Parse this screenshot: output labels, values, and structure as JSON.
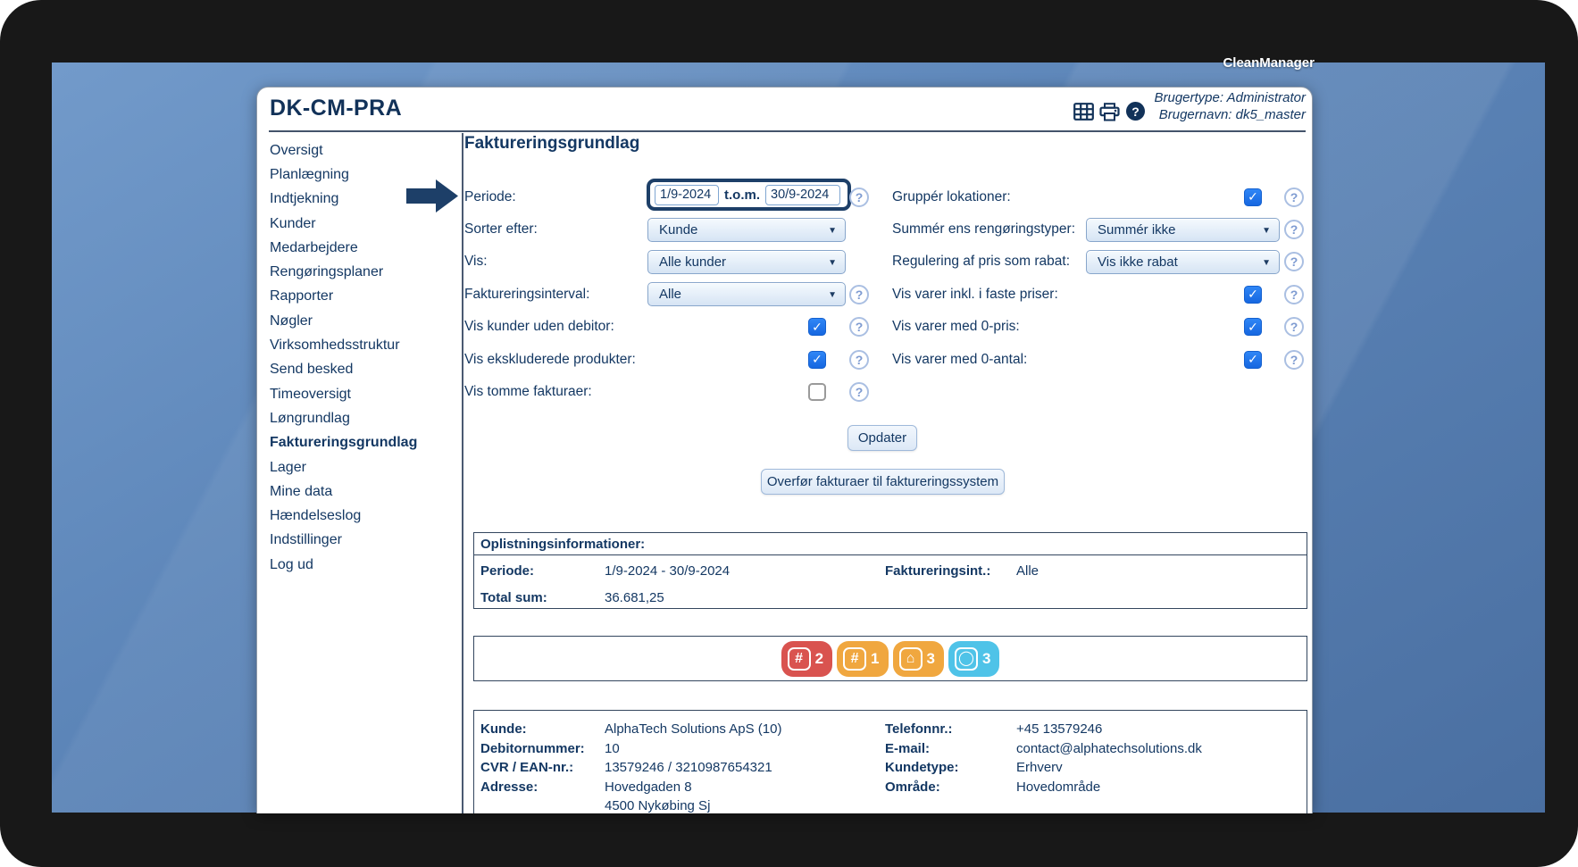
{
  "frame": {
    "brand": "CleanManager"
  },
  "window": {
    "title": "DK-CM-PRA",
    "user": {
      "line1": "Brugertype: Administrator",
      "line2": "Brugernavn: dk5_master"
    },
    "toolbar_icons": [
      "table-icon",
      "print-icon",
      "help-icon"
    ]
  },
  "sidebar": {
    "items": [
      {
        "label": "Oversigt"
      },
      {
        "label": "Planlægning"
      },
      {
        "label": "Indtjekning"
      },
      {
        "label": "Kunder"
      },
      {
        "label": "Medarbejdere"
      },
      {
        "label": "Rengøringsplaner"
      },
      {
        "label": "Rapporter"
      },
      {
        "label": "Nøgler"
      },
      {
        "label": "Virksomhedsstruktur"
      },
      {
        "label": "Send besked"
      },
      {
        "label": "Timeoversigt"
      },
      {
        "label": "Løngrundlag"
      },
      {
        "label": "Faktureringsgrundlag",
        "active": true
      },
      {
        "label": "Lager"
      },
      {
        "label": "Mine data"
      },
      {
        "label": "Hændelseslog"
      },
      {
        "label": "Indstillinger"
      },
      {
        "label": "Log ud"
      }
    ]
  },
  "main": {
    "title": "Faktureringsgrundlag",
    "form": {
      "periode": {
        "label": "Periode:",
        "from": "1/9-2024",
        "separator": "t.o.m.",
        "to": "30/9-2024"
      },
      "sorter": {
        "label": "Sorter efter:",
        "value": "Kunde"
      },
      "vis": {
        "label": "Vis:",
        "value": "Alle kunder"
      },
      "interval": {
        "label": "Faktureringsinterval:",
        "value": "Alle"
      },
      "uden_debitor": {
        "label": "Vis kunder uden debitor:",
        "checked": true
      },
      "ekskluderede": {
        "label": "Vis ekskluderede produkter:",
        "checked": true
      },
      "tomme": {
        "label": "Vis tomme fakturaer:",
        "checked": false
      },
      "gruppe": {
        "label": "Gruppér lokationer:",
        "checked": true
      },
      "summer": {
        "label": "Summér ens rengøringstyper:",
        "value": "Summér ikke"
      },
      "regulering": {
        "label": "Regulering af pris som rabat:",
        "value": "Vis ikke rabat"
      },
      "faste_priser": {
        "label": "Vis varer inkl. i faste priser:",
        "checked": true
      },
      "nul_pris": {
        "label": "Vis varer med 0-pris:",
        "checked": true
      },
      "nul_antal": {
        "label": "Vis varer med 0-antal:",
        "checked": true
      }
    },
    "buttons": {
      "opdater": "Opdater",
      "overfor": "Overfør fakturaer til faktureringssystem"
    },
    "summary": {
      "header": "Oplistningsinformationer:",
      "periode_label": "Periode:",
      "periode_value": "1/9-2024 - 30/9-2024",
      "interval_label": "Faktureringsint.:",
      "interval_value": "Alle",
      "total_label": "Total sum:",
      "total_value": "36.681,25"
    },
    "badges": [
      {
        "color": "#d9534f",
        "glyph": "#",
        "icon": "hash-icon",
        "count": "2"
      },
      {
        "color": "#f0a73f",
        "glyph": "#",
        "icon": "hash-icon",
        "count": "1"
      },
      {
        "color": "#f0a73f",
        "glyph": "⌂",
        "icon": "house-icon",
        "count": "3"
      },
      {
        "color": "#4fc3e8",
        "glyph": "◯",
        "icon": "machine-icon",
        "count": "3"
      }
    ],
    "customer": {
      "rows": [
        {
          "l1": "Kunde:",
          "v1": "AlphaTech Solutions ApS (10)",
          "l2": "Telefonnr.:",
          "v2": "+45 13579246"
        },
        {
          "l1": "Debitornummer:",
          "v1": "10",
          "l2": "E-mail:",
          "v2": "contact@alphatechsolutions.dk"
        },
        {
          "l1": "CVR / EAN-nr.:",
          "v1": "13579246 / 3210987654321",
          "l2": "Kundetype:",
          "v2": "Erhverv"
        },
        {
          "l1": "Adresse:",
          "v1": "Hovedgaden 8",
          "l2": "Område:",
          "v2": "Hovedområde"
        },
        {
          "l1": "",
          "v1": "4500 Nykøbing Sj",
          "l2": "",
          "v2": ""
        }
      ]
    },
    "colors": {
      "accent_navy": "#1d3f68",
      "checkbox_blue": "#1a73e8",
      "badge_red": "#d9534f",
      "badge_orange": "#f0a73f",
      "badge_blue": "#4fc3e8"
    }
  }
}
